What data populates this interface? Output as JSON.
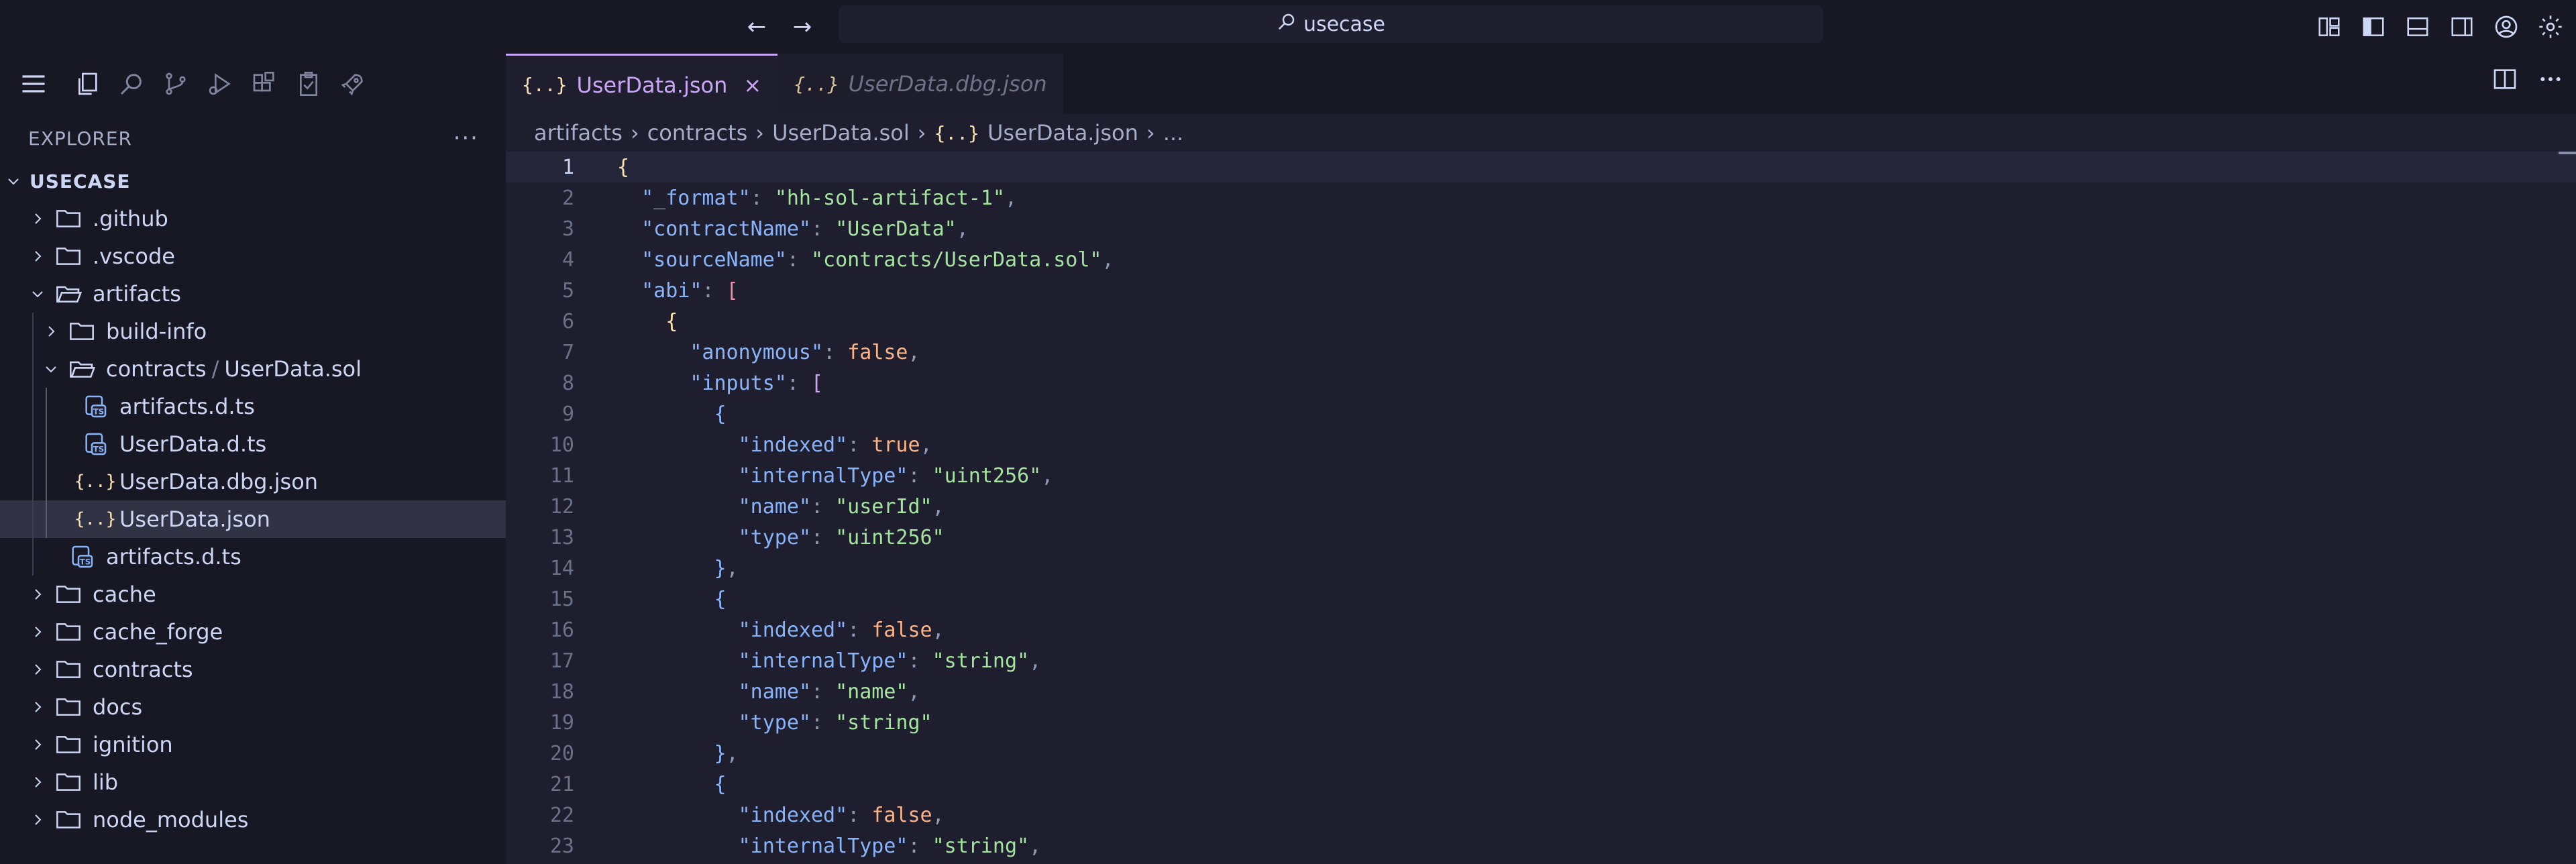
{
  "titlebar": {
    "search_text": "usecase",
    "back_label": "←",
    "forward_label": "→"
  },
  "explorer": {
    "title": "EXPLORER",
    "more_label": "···",
    "root": "USECASE",
    "items": [
      {
        "label": ".github",
        "type": "folder",
        "icon": "folder-github-icon",
        "depth": 1,
        "chevron": "right"
      },
      {
        "label": ".vscode",
        "type": "folder",
        "icon": "folder-vscode-icon",
        "depth": 1,
        "chevron": "right"
      },
      {
        "label": "artifacts",
        "type": "folder",
        "icon": "folder-open-icon",
        "depth": 1,
        "chevron": "down"
      },
      {
        "label": "build-info",
        "type": "folder",
        "icon": "folder-icon",
        "depth": 2,
        "chevron": "right"
      },
      {
        "label_a": "contracts",
        "sep": "/",
        "label_b": "UserData.sol",
        "type": "folder",
        "icon": "folder-open-icon",
        "depth": 2,
        "chevron": "down"
      },
      {
        "label": "artifacts.d.ts",
        "type": "file",
        "icon": "typescript-def-icon",
        "depth": 3
      },
      {
        "label": "UserData.d.ts",
        "type": "file",
        "icon": "typescript-def-icon",
        "depth": 3
      },
      {
        "label": "UserData.dbg.json",
        "type": "file",
        "icon": "json-icon",
        "depth": 3
      },
      {
        "label": "UserData.json",
        "type": "file",
        "icon": "json-icon",
        "depth": 3,
        "selected": true
      },
      {
        "label": "artifacts.d.ts",
        "type": "file",
        "icon": "typescript-def-icon",
        "depth": 2
      },
      {
        "label": "cache",
        "type": "folder",
        "icon": "folder-cache-icon",
        "depth": 1,
        "chevron": "right"
      },
      {
        "label": "cache_forge",
        "type": "folder",
        "icon": "folder-icon",
        "depth": 1,
        "chevron": "right"
      },
      {
        "label": "contracts",
        "type": "folder",
        "icon": "folder-icon",
        "depth": 1,
        "chevron": "right"
      },
      {
        "label": "docs",
        "type": "folder",
        "icon": "folder-docs-icon",
        "depth": 1,
        "chevron": "right"
      },
      {
        "label": "ignition",
        "type": "folder",
        "icon": "folder-icon",
        "depth": 1,
        "chevron": "right"
      },
      {
        "label": "lib",
        "type": "folder",
        "icon": "folder-icon",
        "depth": 1,
        "chevron": "right"
      },
      {
        "label": "node_modules",
        "type": "folder",
        "icon": "folder-node-icon",
        "depth": 1,
        "chevron": "right"
      }
    ]
  },
  "tabs": [
    {
      "label": "UserData.json",
      "icon_text": "{..}",
      "active": true,
      "close": "×"
    },
    {
      "label": "UserData.dbg.json",
      "icon_text": "{..}",
      "active": false
    }
  ],
  "breadcrumb": {
    "parts": [
      "artifacts",
      "contracts",
      "UserData.sol"
    ],
    "file_icon": "{..}",
    "file": "UserData.json",
    "tail": "...",
    "sep": "›"
  },
  "code": {
    "current_line": 1,
    "lines": [
      [
        [
          "{",
          "br1"
        ]
      ],
      [
        [
          "  ",
          "p"
        ],
        [
          "\"_format\"",
          "k"
        ],
        [
          ": ",
          "p"
        ],
        [
          "\"hh-sol-artifact-1\"",
          "s"
        ],
        [
          ",",
          "p"
        ]
      ],
      [
        [
          "  ",
          "p"
        ],
        [
          "\"contractName\"",
          "k"
        ],
        [
          ": ",
          "p"
        ],
        [
          "\"UserData\"",
          "s"
        ],
        [
          ",",
          "p"
        ]
      ],
      [
        [
          "  ",
          "p"
        ],
        [
          "\"sourceName\"",
          "k"
        ],
        [
          ": ",
          "p"
        ],
        [
          "\"contracts/UserData.sol\"",
          "s"
        ],
        [
          ",",
          "p"
        ]
      ],
      [
        [
          "  ",
          "p"
        ],
        [
          "\"abi\"",
          "k"
        ],
        [
          ": ",
          "p"
        ],
        [
          "[",
          "br2"
        ]
      ],
      [
        [
          "    ",
          "p"
        ],
        [
          "{",
          "br3"
        ]
      ],
      [
        [
          "      ",
          "p"
        ],
        [
          "\"anonymous\"",
          "k"
        ],
        [
          ": ",
          "p"
        ],
        [
          "false",
          "b"
        ],
        [
          ",",
          "p"
        ]
      ],
      [
        [
          "      ",
          "p"
        ],
        [
          "\"inputs\"",
          "k"
        ],
        [
          ": ",
          "p"
        ],
        [
          "[",
          "br4"
        ]
      ],
      [
        [
          "        ",
          "p"
        ],
        [
          "{",
          "k"
        ]
      ],
      [
        [
          "          ",
          "p"
        ],
        [
          "\"indexed\"",
          "k"
        ],
        [
          ": ",
          "p"
        ],
        [
          "true",
          "b"
        ],
        [
          ",",
          "p"
        ]
      ],
      [
        [
          "          ",
          "p"
        ],
        [
          "\"internalType\"",
          "k"
        ],
        [
          ": ",
          "p"
        ],
        [
          "\"uint256\"",
          "s"
        ],
        [
          ",",
          "p"
        ]
      ],
      [
        [
          "          ",
          "p"
        ],
        [
          "\"name\"",
          "k"
        ],
        [
          ": ",
          "p"
        ],
        [
          "\"userId\"",
          "s"
        ],
        [
          ",",
          "p"
        ]
      ],
      [
        [
          "          ",
          "p"
        ],
        [
          "\"type\"",
          "k"
        ],
        [
          ": ",
          "p"
        ],
        [
          "\"uint256\"",
          "s"
        ]
      ],
      [
        [
          "        ",
          "p"
        ],
        [
          "}",
          "k"
        ],
        [
          ",",
          "p"
        ]
      ],
      [
        [
          "        ",
          "p"
        ],
        [
          "{",
          "k"
        ]
      ],
      [
        [
          "          ",
          "p"
        ],
        [
          "\"indexed\"",
          "k"
        ],
        [
          ": ",
          "p"
        ],
        [
          "false",
          "b"
        ],
        [
          ",",
          "p"
        ]
      ],
      [
        [
          "          ",
          "p"
        ],
        [
          "\"internalType\"",
          "k"
        ],
        [
          ": ",
          "p"
        ],
        [
          "\"string\"",
          "s"
        ],
        [
          ",",
          "p"
        ]
      ],
      [
        [
          "          ",
          "p"
        ],
        [
          "\"name\"",
          "k"
        ],
        [
          ": ",
          "p"
        ],
        [
          "\"name\"",
          "s"
        ],
        [
          ",",
          "p"
        ]
      ],
      [
        [
          "          ",
          "p"
        ],
        [
          "\"type\"",
          "k"
        ],
        [
          ": ",
          "p"
        ],
        [
          "\"string\"",
          "s"
        ]
      ],
      [
        [
          "        ",
          "p"
        ],
        [
          "}",
          "k"
        ],
        [
          ",",
          "p"
        ]
      ],
      [
        [
          "        ",
          "p"
        ],
        [
          "{",
          "k"
        ]
      ],
      [
        [
          "          ",
          "p"
        ],
        [
          "\"indexed\"",
          "k"
        ],
        [
          ": ",
          "p"
        ],
        [
          "false",
          "b"
        ],
        [
          ",",
          "p"
        ]
      ],
      [
        [
          "          ",
          "p"
        ],
        [
          "\"internalType\"",
          "k"
        ],
        [
          ": ",
          "p"
        ],
        [
          "\"string\"",
          "s"
        ],
        [
          ",",
          "p"
        ]
      ]
    ]
  },
  "colors": {
    "accent": "#cba6f7",
    "json_icon": "#f9e2af"
  }
}
